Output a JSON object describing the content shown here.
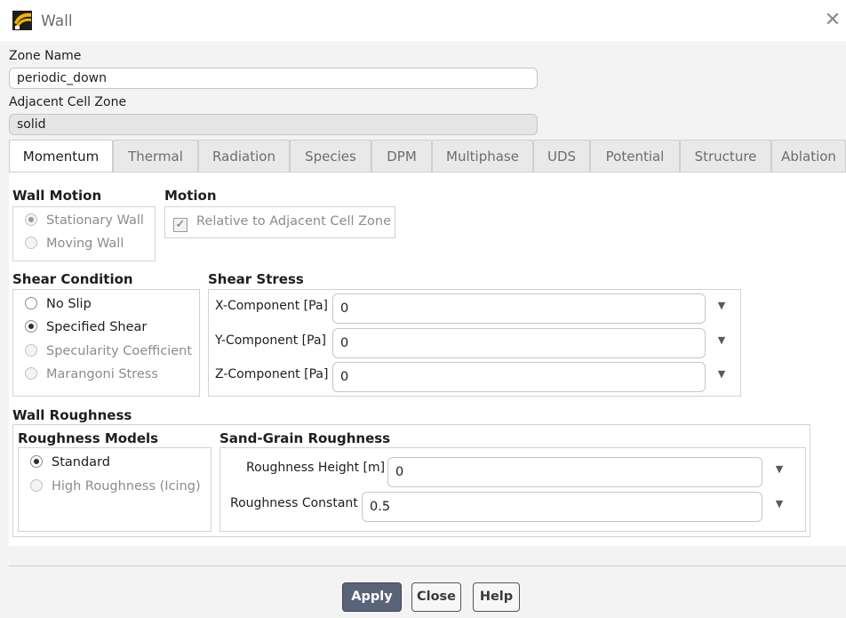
{
  "window": {
    "title": "Wall",
    "close_glyph": "✕",
    "logo_icon": "ansys-fluent-logo"
  },
  "zone_name": {
    "label": "Zone Name",
    "value": "periodic_down"
  },
  "adjacent_cell_zone": {
    "label": "Adjacent Cell Zone",
    "value": "solid"
  },
  "tabs": [
    {
      "label": "Momentum",
      "active": true
    },
    {
      "label": "Thermal"
    },
    {
      "label": "Radiation"
    },
    {
      "label": "Species"
    },
    {
      "label": "DPM"
    },
    {
      "label": "Multiphase"
    },
    {
      "label": "UDS"
    },
    {
      "label": "Potential"
    },
    {
      "label": "Structure"
    },
    {
      "label": "Ablation"
    }
  ],
  "wall_motion": {
    "title": "Wall Motion",
    "options": [
      {
        "label": "Stationary Wall",
        "selected": true,
        "enabled": false
      },
      {
        "label": "Moving Wall",
        "selected": false,
        "enabled": false
      }
    ]
  },
  "motion": {
    "title": "Motion",
    "relative_checkbox": {
      "label": "Relative to Adjacent Cell Zone",
      "checked": true,
      "enabled": false,
      "glyph": "✓"
    }
  },
  "shear_condition": {
    "title": "Shear Condition",
    "options": [
      {
        "label": "No Slip",
        "selected": false,
        "enabled": true
      },
      {
        "label": "Specified Shear",
        "selected": true,
        "enabled": true
      },
      {
        "label": "Specularity Coefficient",
        "selected": false,
        "enabled": false
      },
      {
        "label": "Marangoni Stress",
        "selected": false,
        "enabled": false
      }
    ]
  },
  "shear_stress": {
    "title": "Shear Stress",
    "fields": [
      {
        "label": "X-Component [Pa]",
        "value": "0"
      },
      {
        "label": "Y-Component [Pa]",
        "value": "0"
      },
      {
        "label": "Z-Component [Pa]",
        "value": "0"
      }
    ],
    "arrow_glyph": "▼"
  },
  "wall_roughness": {
    "title": "Wall Roughness",
    "models": {
      "title": "Roughness Models",
      "options": [
        {
          "label": "Standard",
          "selected": true,
          "enabled": true
        },
        {
          "label": "High Roughness (Icing)",
          "selected": false,
          "enabled": false
        }
      ]
    },
    "sand_grain": {
      "title": "Sand-Grain Roughness",
      "fields": [
        {
          "label": "Roughness Height [m]",
          "value": "0"
        },
        {
          "label": "Roughness Constant",
          "value": "0.5"
        }
      ]
    }
  },
  "buttons": {
    "apply": "Apply",
    "close": "Close",
    "help": "Help"
  },
  "colors": {
    "primary_button": "#5a6478",
    "dialog_bg": "#f3f3f3"
  }
}
